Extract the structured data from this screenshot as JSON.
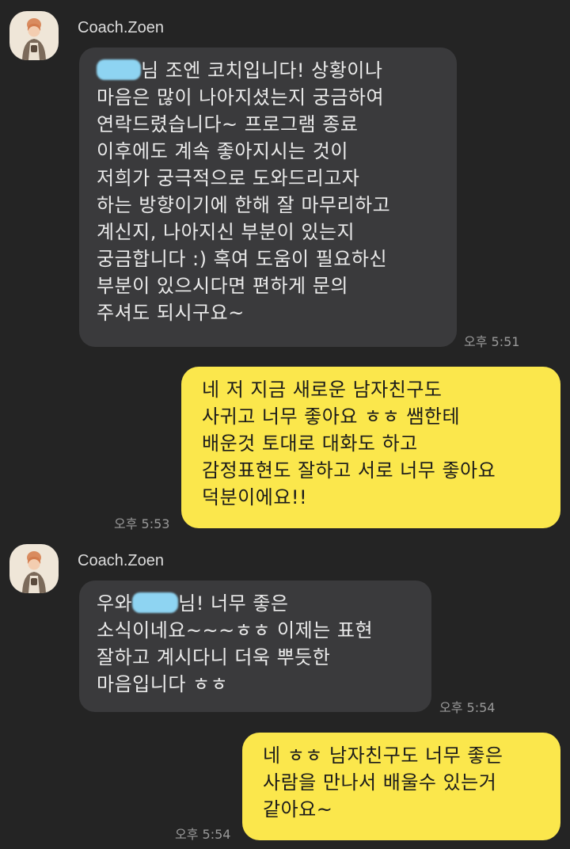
{
  "messages": [
    {
      "sender": "Coach.Zoen",
      "first_line_suffix": "님 조엔 코치입니다! 상황이나",
      "lines": [
        "마음은 많이 나아지셨는지 궁금하여",
        "연락드렸습니다~ 프로그램 종료",
        "이후에도 계속 좋아지시는 것이",
        "저희가 궁극적으로 도와드리고자",
        "하는 방향이기에 한해 잘 마무리하고",
        "계신지, 나아지신 부분이 있는지",
        "궁금합니다 :) 혹여 도움이 필요하신",
        "부분이 있으시다면 편하게 문의",
        "주셔도 되시구요~"
      ],
      "time": "오후 5:51"
    },
    {
      "lines": [
        "네 저 지금 새로운 남자친구도",
        "사귀고 너무 좋아요  ㅎㅎ 쌤한테",
        "배운것 토대로 대화도 하고",
        "감정표현도 잘하고 서로 너무 좋아요",
        "덕분이에요!!"
      ],
      "time": "오후 5:53"
    },
    {
      "sender": "Coach.Zoen",
      "first_line_prefix": "우와",
      "first_line_suffix": "님! 너무 좋은",
      "lines": [
        "소식이네요~~~ㅎㅎ 이제는 표현",
        "잘하고 계시다니 더욱 뿌듯한",
        "마음입니다 ㅎㅎ"
      ],
      "time": "오후 5:54"
    },
    {
      "lines": [
        "네 ㅎㅎ 남자친구도 너무 좋은",
        "사람을 만나서 배울수 있는거",
        "같아요~"
      ],
      "time": "오후 5:54"
    }
  ],
  "colors": {
    "background": "#242424",
    "incoming_bubble": "#3a3a3c",
    "outgoing_bubble": "#fbe74c",
    "redaction": "#8ed4f2"
  },
  "icons": {
    "avatar": "woman-with-coffee-avatar-icon"
  }
}
